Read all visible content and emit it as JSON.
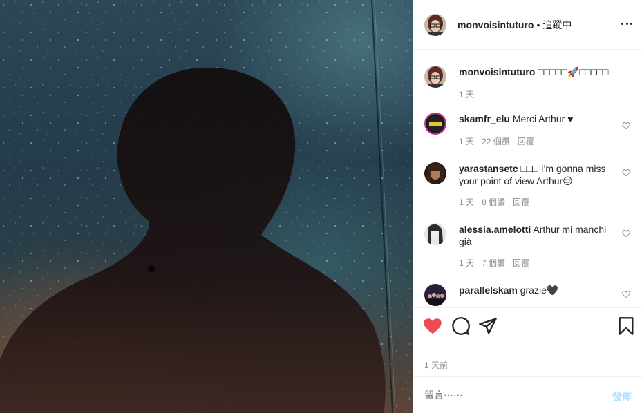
{
  "post": {
    "username": "monvoisintuturo",
    "separator": "•",
    "follow_status": "追蹤中"
  },
  "caption": {
    "username": "monvoisintuturo",
    "text": "□□□□□🚀□□□□□",
    "time": "1 天"
  },
  "comments": [
    {
      "username": "skamfr_elu",
      "text": "Merci Arthur ♥",
      "time": "1 天",
      "likes": "22 個讚",
      "reply": "回覆"
    },
    {
      "username": "yarastansetc",
      "text": "□□□ I'm gonna miss your point of view Arthur😒",
      "time": "1 天",
      "likes": "8 個讚",
      "reply": "回覆"
    },
    {
      "username": "alessia.amelotti",
      "text": "Arthur mi manchi già",
      "time": "1 天",
      "likes": "7 個讚",
      "reply": "回覆"
    },
    {
      "username": "parallelskam",
      "text": "grazie🖤"
    }
  ],
  "footer": {
    "timestamp": "1 天前",
    "comment_placeholder": "留言⋯⋯",
    "post_label": "發佈"
  },
  "colors": {
    "like_red": "#ed4956",
    "post_disabled": "#b2dffc",
    "meta_gray": "#8e8e8e"
  },
  "icons": [
    "more-icon",
    "heart-icon",
    "comment-icon",
    "share-icon",
    "bookmark-icon"
  ]
}
